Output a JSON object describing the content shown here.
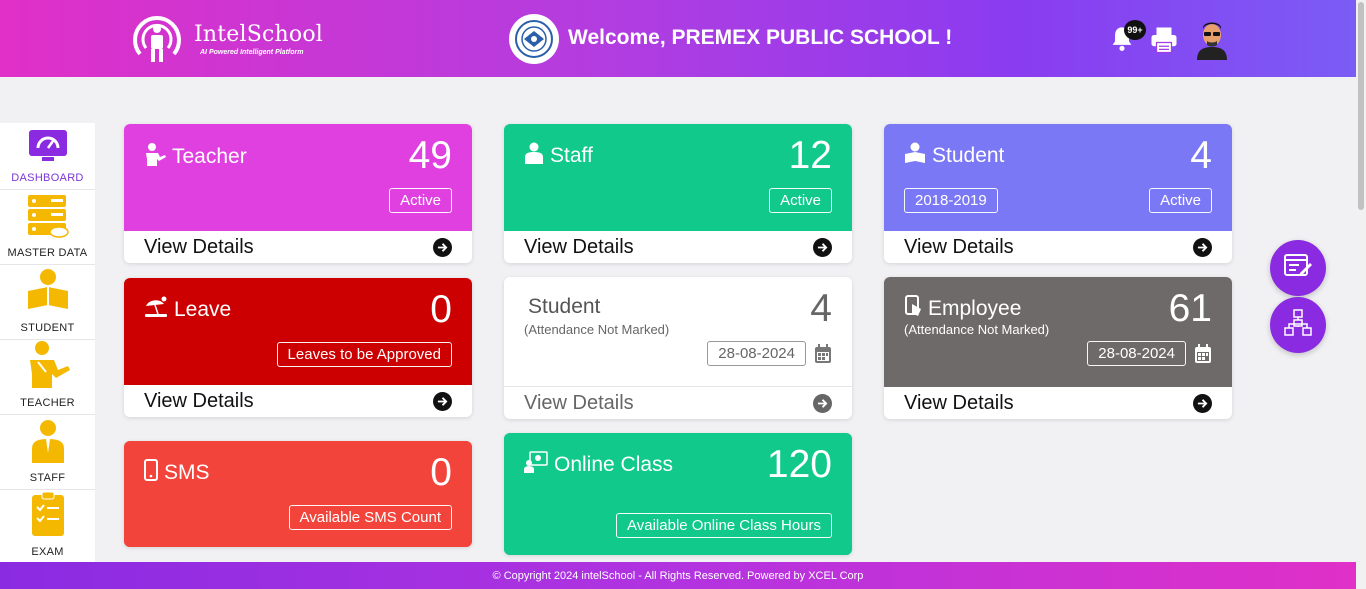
{
  "header": {
    "logo_name": "IntelSchool",
    "logo_tagline": "AI Powered Intelligent Platform",
    "welcome": "Welcome, PREMEX PUBLIC SCHOOL !",
    "notification_count": "99+"
  },
  "sidebar": {
    "items": [
      {
        "label": "DASHBOARD",
        "icon": "dashboard-icon",
        "active": true
      },
      {
        "label": "MASTER DATA",
        "icon": "server-icon"
      },
      {
        "label": "STUDENT",
        "icon": "student-icon"
      },
      {
        "label": "TEACHER",
        "icon": "teacher-icon"
      },
      {
        "label": "STAFF",
        "icon": "staff-icon"
      },
      {
        "label": "EXAM",
        "icon": "clipboard-icon"
      }
    ]
  },
  "cards": {
    "teacher": {
      "title": "Teacher",
      "count": "49",
      "pill": "Active",
      "footer": "View Details",
      "color": "#e040e0"
    },
    "staff": {
      "title": "Staff",
      "count": "12",
      "pill": "Active",
      "footer": "View Details",
      "color": "#10c98a"
    },
    "student": {
      "title": "Student",
      "count": "4",
      "year": "2018-2019",
      "pill": "Active",
      "footer": "View Details",
      "color": "#7b78f5"
    },
    "leave": {
      "title": "Leave",
      "count": "0",
      "pill": "Leaves to be Approved",
      "footer": "View Details",
      "color": "#cc0000"
    },
    "student_attendance": {
      "title": "Student",
      "subtitle": "(Attendance Not Marked)",
      "count": "4",
      "date": "28-08-2024",
      "footer": "View Details",
      "color": "#ffffff"
    },
    "employee": {
      "title": "Employee",
      "subtitle": "(Attendance Not Marked)",
      "count": "61",
      "date": "28-08-2024",
      "footer": "View Details",
      "color": "#6e6a69"
    },
    "sms": {
      "title": "SMS",
      "count": "0",
      "pill": "Available SMS Count",
      "color": "#f3443c"
    },
    "online_class": {
      "title": "Online Class",
      "count": "120",
      "pill": "Available Online Class Hours",
      "color": "#10c98a"
    }
  },
  "footer": {
    "copyright": "© Copyright 2024 intelSchool - All Rights Reserved. Powered by XCEL Corp"
  }
}
